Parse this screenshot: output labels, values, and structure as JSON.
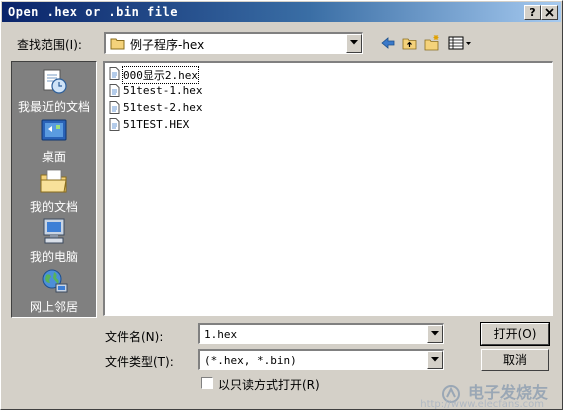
{
  "window": {
    "title": "Open .hex or .bin file",
    "help_button": "?",
    "close_button": "X"
  },
  "lookin": {
    "label": "查找范围(I):",
    "value": "例子程序-hex"
  },
  "places": [
    {
      "label": "我最近的文档",
      "icon": "recent-documents-icon"
    },
    {
      "label": "桌面",
      "icon": "desktop-icon"
    },
    {
      "label": "我的文档",
      "icon": "my-documents-icon"
    },
    {
      "label": "我的电脑",
      "icon": "my-computer-icon"
    },
    {
      "label": "网上邻居",
      "icon": "network-places-icon"
    }
  ],
  "files": [
    {
      "name": "000显示2.hex"
    },
    {
      "name": "51test-1.hex"
    },
    {
      "name": "51test-2.hex"
    },
    {
      "name": "51TEST.HEX"
    }
  ],
  "filename": {
    "label": "文件名(N):",
    "value": "1.hex"
  },
  "filetype": {
    "label": "文件类型(T):",
    "value": "(*.hex, *.bin)"
  },
  "readonly": {
    "label": "以只读方式打开(R)",
    "checked": false
  },
  "buttons": {
    "open": "打开(O)",
    "cancel": "取消"
  },
  "watermark": {
    "text": "电子发烧友",
    "url": "http://www.elecfans.com"
  }
}
